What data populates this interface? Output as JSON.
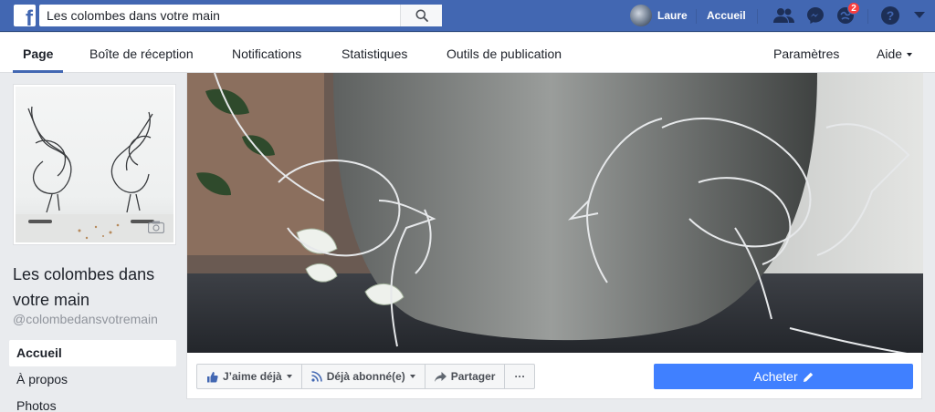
{
  "topbar": {
    "logo": "f",
    "search": {
      "value": "Les colombes dans votre main",
      "placeholder": ""
    },
    "user": {
      "name": "Laure"
    },
    "home_label": "Accueil",
    "notifications_count": "2",
    "icons": [
      "search-icon",
      "friends-icon",
      "messenger-icon",
      "notifications-icon",
      "help-icon",
      "account-menu-icon"
    ],
    "brand_color": "#4267b2"
  },
  "pagebar": {
    "tabs": [
      {
        "label": "Page",
        "active": true
      },
      {
        "label": "Boîte de réception"
      },
      {
        "label": "Notifications"
      },
      {
        "label": "Statistiques"
      },
      {
        "label": "Outils de publication"
      }
    ],
    "settings_label": "Paramètres",
    "help_label": "Aide"
  },
  "page": {
    "name": "Les colombes dans votre main",
    "handle": "@colombedansvotremain"
  },
  "sidenav": {
    "items": [
      {
        "label": "Accueil",
        "active": true
      },
      {
        "label": "À propos"
      },
      {
        "label": "Photos"
      }
    ]
  },
  "actions": {
    "like_label": "J’aime déjà",
    "follow_label": "Déjà abonné(e)",
    "share_label": "Partager",
    "more_label": "···",
    "buy_label": "Acheter",
    "buy_color": "#4080ff"
  }
}
